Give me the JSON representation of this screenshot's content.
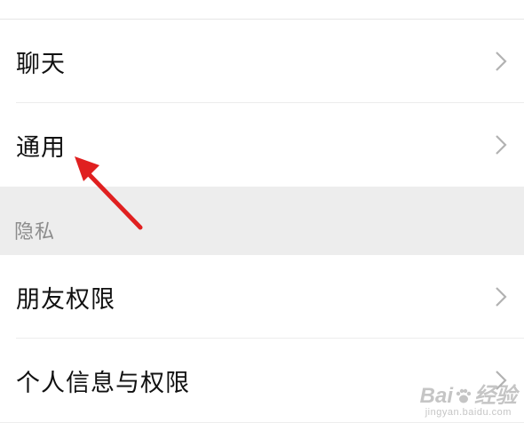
{
  "settings": {
    "rows_top": [
      {
        "label": "聊天"
      },
      {
        "label": "通用"
      }
    ],
    "privacy_section_title": "隐私",
    "rows_privacy": [
      {
        "label": "朋友权限"
      },
      {
        "label": "个人信息与权限"
      }
    ]
  },
  "watermark": {
    "main_left": "Bai",
    "main_right": "经验",
    "sub": "jingyan.baidu.com"
  },
  "colors": {
    "arrow": "#e02020",
    "background": "#ededed",
    "chevron": "#b2b2b2"
  }
}
